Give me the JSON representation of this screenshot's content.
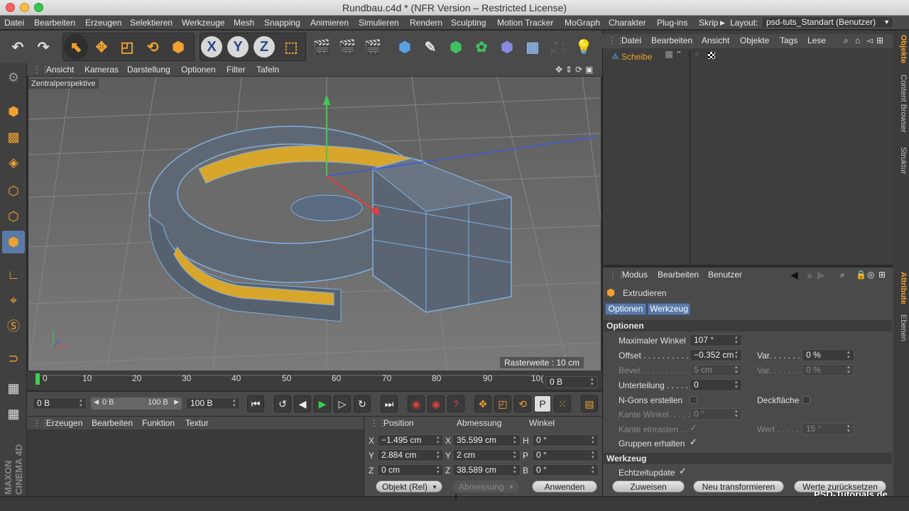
{
  "window": {
    "title": "Rundbau.c4d * (NFR Version – Restricted License)"
  },
  "menubar": {
    "items": [
      "Datei",
      "Bearbeiten",
      "Erzeugen",
      "Selektieren",
      "Werkzeuge",
      "Mesh",
      "Snapping",
      "Animieren",
      "Simulieren",
      "Rendern",
      "Sculpting",
      "Motion Tracker",
      "MoGraph",
      "Charakter",
      "Plug-ins",
      "Skrip"
    ],
    "layout_label": "Layout:",
    "layout_value": "psd-tuts_Standart (Benutzer)"
  },
  "toolbar": {
    "axis_x": "X",
    "axis_y": "Y",
    "axis_z": "Z"
  },
  "viewport": {
    "menu": [
      "Ansicht",
      "Kameras",
      "Darstellung",
      "Optionen",
      "Filter",
      "Tafeln"
    ],
    "perspective_label": "Zentralperspektive",
    "raster_label": "Rasterweite : 10 cm"
  },
  "timeline": {
    "ticks": [
      "0",
      "10",
      "20",
      "30",
      "40",
      "50",
      "60",
      "70",
      "80",
      "90",
      "10("
    ],
    "frame_display": "0 B",
    "start_field": "0 B",
    "range_start": "0 B",
    "range_end": "100 B",
    "end_field": "100 B"
  },
  "material_panel": {
    "menu": [
      "Erzeugen",
      "Bearbeiten",
      "Funktion",
      "Textur"
    ]
  },
  "coord_panel": {
    "headers": [
      "Position",
      "Abmessung",
      "Winkel"
    ],
    "rows": [
      {
        "axis": "X",
        "pos": "−1.495 cm",
        "size_axis": "X",
        "size": "35.599 cm",
        "rot_axis": "H",
        "rot": "0 °"
      },
      {
        "axis": "Y",
        "pos": "2.884 cm",
        "size_axis": "Y",
        "size": "2 cm",
        "rot_axis": "P",
        "rot": "0 °"
      },
      {
        "axis": "Z",
        "pos": "0 cm",
        "size_axis": "Z",
        "size": "38.589 cm",
        "rot_axis": "B",
        "rot": "0 °"
      }
    ],
    "mode_select": "Objekt (Rel)",
    "size_select": "Abmessung",
    "apply_label": "Anwenden"
  },
  "object_panel": {
    "menu": [
      "Datei",
      "Bearbeiten",
      "Ansicht",
      "Objekte",
      "Tags",
      "Lese"
    ],
    "object_name": "Scheibe"
  },
  "side_tabs": [
    "Objekte",
    "Content Browser",
    "Struktur",
    "Attribute",
    "Ebenen"
  ],
  "attr_panel": {
    "menu": [
      "Modus",
      "Bearbeiten",
      "Benutzer"
    ],
    "tool_name": "Extrudieren",
    "tabs": [
      "Optionen",
      "Werkzeug"
    ],
    "section_options": "Optionen",
    "max_angle_label": "Maximaler Winkel",
    "max_angle_value": "107 °",
    "offset_label": "Offset . . . . . . . . . . .",
    "offset_value": "−0.352 cm",
    "var1_label": "Var. . . . . . .",
    "var1_value": "0 %",
    "bevel_label": "Bevel . . . . . . . . . . .",
    "bevel_value": "5 cm",
    "var2_label": "Var. . . . . . .",
    "var2_value": "0 %",
    "subdiv_label": "Unterteilung . . . . .",
    "subdiv_value": "0",
    "ngons_label": "N-Gons erstellen",
    "cap_label": "Deckfläche",
    "edge_angle_label": "Kante Winkel. . . . .",
    "edge_angle_value": "0 °",
    "edge_snap_label": "Kante einrasten . .",
    "value_label": "Wert . . . . . . .",
    "value_value": "15 °",
    "keep_groups_label": "Gruppen erhalten",
    "section_tool": "Werkzeug",
    "realtime_label": "Echtzeitupdate",
    "assign_label": "Zuweisen",
    "new_transform_label": "Neu transformieren",
    "reset_label": "Werte zurücksetzen"
  },
  "watermark": "PSD-Tutorials.de",
  "brand": "MAXON CINEMA 4D"
}
